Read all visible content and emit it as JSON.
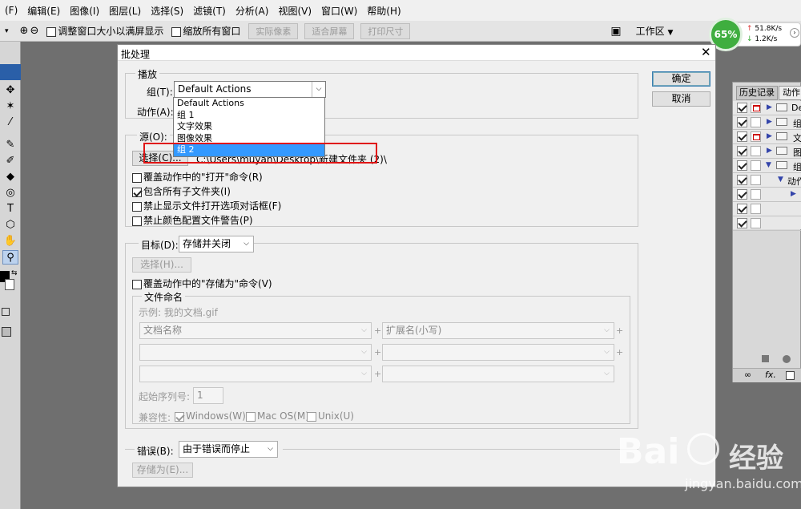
{
  "menubar": {
    "items": [
      "(F)",
      "编辑(E)",
      "图像(I)",
      "图层(L)",
      "选择(S)",
      "滤镜(T)",
      "分析(A)",
      "视图(V)",
      "窗口(W)",
      "帮助(H)"
    ]
  },
  "options_bar": {
    "fit_window_label": "调整窗口大小以满屏显示",
    "zoom_all_label": "缩放所有窗口",
    "actual_pixels": "实际像素",
    "fit_screen": "适合屏幕",
    "print_size": "打印尺寸",
    "workspace": "工作区"
  },
  "speed_widget": {
    "percent": "65%",
    "upload": "51.8K/s",
    "download": "1.2K/s"
  },
  "dialog": {
    "title": "批处理",
    "ok": "确定",
    "cancel": "取消",
    "play": {
      "legend": "播放",
      "group_label": "组(T):",
      "group_value": "Default Actions",
      "action_label": "动作(A):",
      "group_options": [
        "Default Actions",
        "组 1",
        "文字效果",
        "图像效果",
        "组 2"
      ],
      "selected_option": "组 2"
    },
    "source": {
      "legend": "源(O):",
      "choose": "选择(C)...",
      "path": "C:\\Users\\muyan\\Desktop\\新建文件夹 (2)\\",
      "override_open": "覆盖动作中的\"打开\"命令(R)",
      "include_subfolders": "包含所有子文件夹(I)",
      "suppress_options": "禁止显示文件打开选项对话框(F)",
      "suppress_color": "禁止颜色配置文件警告(P)"
    },
    "destination": {
      "legend": "目标(D):",
      "value": "存储并关闭",
      "choose": "选择(H)...",
      "override_save": "覆盖动作中的\"存储为\"命令(V)",
      "naming": {
        "legend": "文件命名",
        "example": "示例: 我的文档.gif",
        "field1": "文档名称",
        "field2": "扩展名(小写)",
        "serial_label": "起始序列号:",
        "serial_value": "1",
        "compat_label": "兼容性:",
        "windows": "Windows(W)",
        "macos": "Mac OS(M)",
        "unix": "Unix(U)"
      }
    },
    "errors": {
      "legend": "错误(B):",
      "value": "由于错误而停止",
      "save_as": "存储为(E)..."
    }
  },
  "right_panel": {
    "tab_history": "历史记录",
    "tab_actions": "动作",
    "rows": [
      "De",
      "组",
      "文",
      "图",
      "组",
      "动作",
      "",
      "",
      ""
    ]
  },
  "watermark": {
    "brand": "Bai",
    "brand_suffix": "经验",
    "url": "jingyan.baidu.com"
  }
}
